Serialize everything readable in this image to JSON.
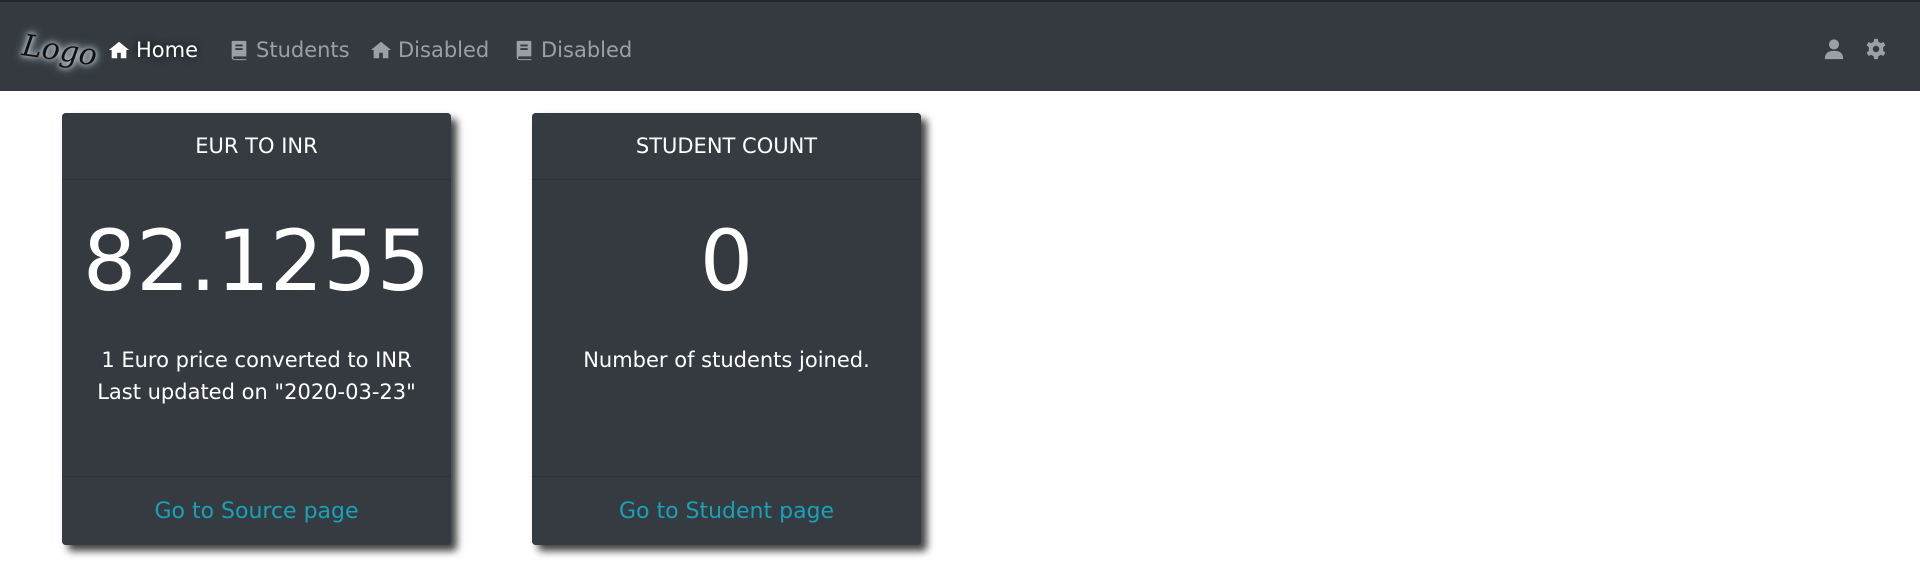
{
  "navbar": {
    "logo_text": "Logo",
    "items": [
      {
        "label": "Home",
        "icon": "home-icon",
        "active": true
      },
      {
        "label": "Students",
        "icon": "book-icon",
        "active": false
      },
      {
        "label": "Disabled",
        "icon": "home-icon",
        "active": false
      },
      {
        "label": "Disabled",
        "icon": "book-icon",
        "active": false
      }
    ],
    "right_icons": [
      "user-icon",
      "gear-icon"
    ]
  },
  "cards": [
    {
      "header": "EUR TO INR",
      "value": "82.1255",
      "text": "1 Euro price converted to INR Last updated on \"2020-03-23\"",
      "link": "Go to Source page"
    },
    {
      "header": "STUDENT COUNT",
      "value": "0",
      "text": "Number of students joined.",
      "link": "Go to Student page"
    }
  ],
  "colors": {
    "navbar_bg": "#343a40",
    "card_bg": "#343a40",
    "link": "#17a2b8",
    "nav_inactive": "#9aa0a6"
  }
}
